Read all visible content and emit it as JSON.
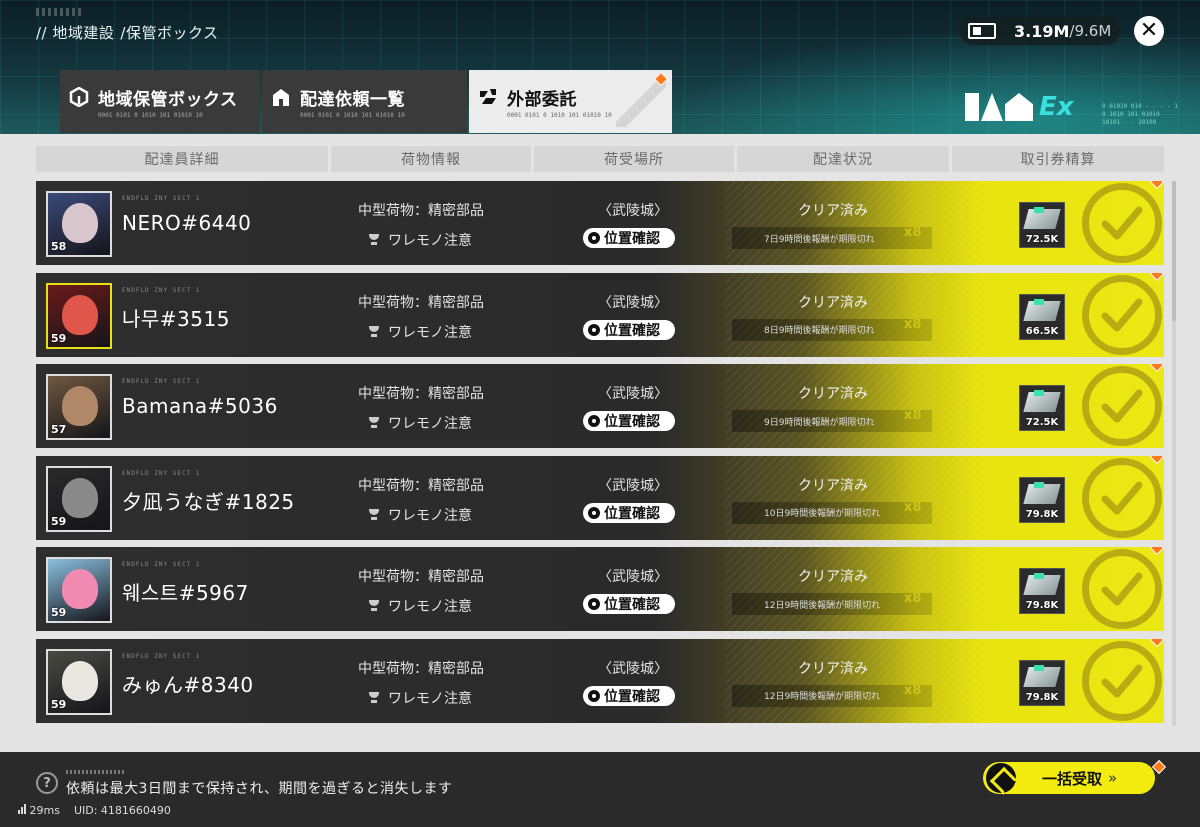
{
  "header": {
    "breadcrumb": [
      "// 地域建設",
      "/保管ボックス"
    ],
    "currency": {
      "value": "3.19M",
      "max": "/9.6M",
      "icon": "battery-icon"
    },
    "close_icon": "close-icon",
    "brand": "Ex"
  },
  "tabs": [
    {
      "label": "地域保管ボックス",
      "sub": "0001 0101 0 1010 101 01010 10",
      "icon": "cube-icon",
      "active": false
    },
    {
      "label": "配達依頼一覧",
      "sub": "0001 0101 0 1010 101 01010 10",
      "icon": "house-icon",
      "active": false
    },
    {
      "label": "外部委託",
      "sub": "0001 0101 0 1010 101 01010 10",
      "icon": "handshake-icon",
      "active": true
    }
  ],
  "columns": [
    "配達員詳細",
    "荷物情報",
    "荷受場所",
    "配達状況",
    "取引券精算"
  ],
  "rows": [
    {
      "name": "NERO#6440",
      "level": "58",
      "cargo": "中型荷物：精密部品",
      "note": "ワレモノ注意",
      "location": "〈武陵城〉",
      "locate_label": "位置確認",
      "status": "クリア済み",
      "expiry": "7日9時間後報酬が期限切れ",
      "multiplier": "x8",
      "reward": "72.5K",
      "avatar_color": "#3b4a7a",
      "face_color": "#d9c6cc"
    },
    {
      "name": "나무#3515",
      "level": "59",
      "cargo": "中型荷物：精密部品",
      "note": "ワレモノ注意",
      "location": "〈武陵城〉",
      "locate_label": "位置確認",
      "status": "クリア済み",
      "expiry": "8日9時間後報酬が期限切れ",
      "multiplier": "x8",
      "reward": "66.5K",
      "avatar_color": "#6a1a1a",
      "face_color": "#e0564a"
    },
    {
      "name": "Bamana#5036",
      "level": "57",
      "cargo": "中型荷物：精密部品",
      "note": "ワレモノ注意",
      "location": "〈武陵城〉",
      "locate_label": "位置確認",
      "status": "クリア済み",
      "expiry": "9日9時間後報酬が期限切れ",
      "multiplier": "x8",
      "reward": "72.5K",
      "avatar_color": "#6e5840",
      "face_color": "#b08868"
    },
    {
      "name": "夕凪うなぎ#1825",
      "level": "59",
      "cargo": "中型荷物：精密部品",
      "note": "ワレモノ注意",
      "location": "〈武陵城〉",
      "locate_label": "位置確認",
      "status": "クリア済み",
      "expiry": "10日9時間後報酬が期限切れ",
      "multiplier": "x8",
      "reward": "79.8K",
      "avatar_color": "#2a2a2a",
      "face_color": "#8a8a8a"
    },
    {
      "name": "웨스트#5967",
      "level": "59",
      "cargo": "中型荷物：精密部品",
      "note": "ワレモノ注意",
      "location": "〈武陵城〉",
      "locate_label": "位置確認",
      "status": "クリア済み",
      "expiry": "12日9時間後報酬が期限切れ",
      "multiplier": "x8",
      "reward": "79.8K",
      "avatar_color": "#8ac0e0",
      "face_color": "#f08ab0"
    },
    {
      "name": "みゅん#8340",
      "level": "59",
      "cargo": "中型荷物：精密部品",
      "note": "ワレモノ注意",
      "location": "〈武陵城〉",
      "locate_label": "位置確認",
      "status": "クリア済み",
      "expiry": "12日9時間後報酬が期限切れ",
      "multiplier": "x8",
      "reward": "79.8K",
      "avatar_color": "#4a4a44",
      "face_color": "#e8e8e0"
    }
  ],
  "footer": {
    "note": "依頼は最大3日間まで保持され、期間を過ぎると消失します",
    "collect_label": "一括受取",
    "collect_arrow": "»",
    "ping": "29ms",
    "uid": "UID: 4181660490"
  },
  "colors": {
    "accent": "#f4ec0e",
    "badge": "#ff7a1a",
    "row_bg": "#2e2e2e"
  }
}
